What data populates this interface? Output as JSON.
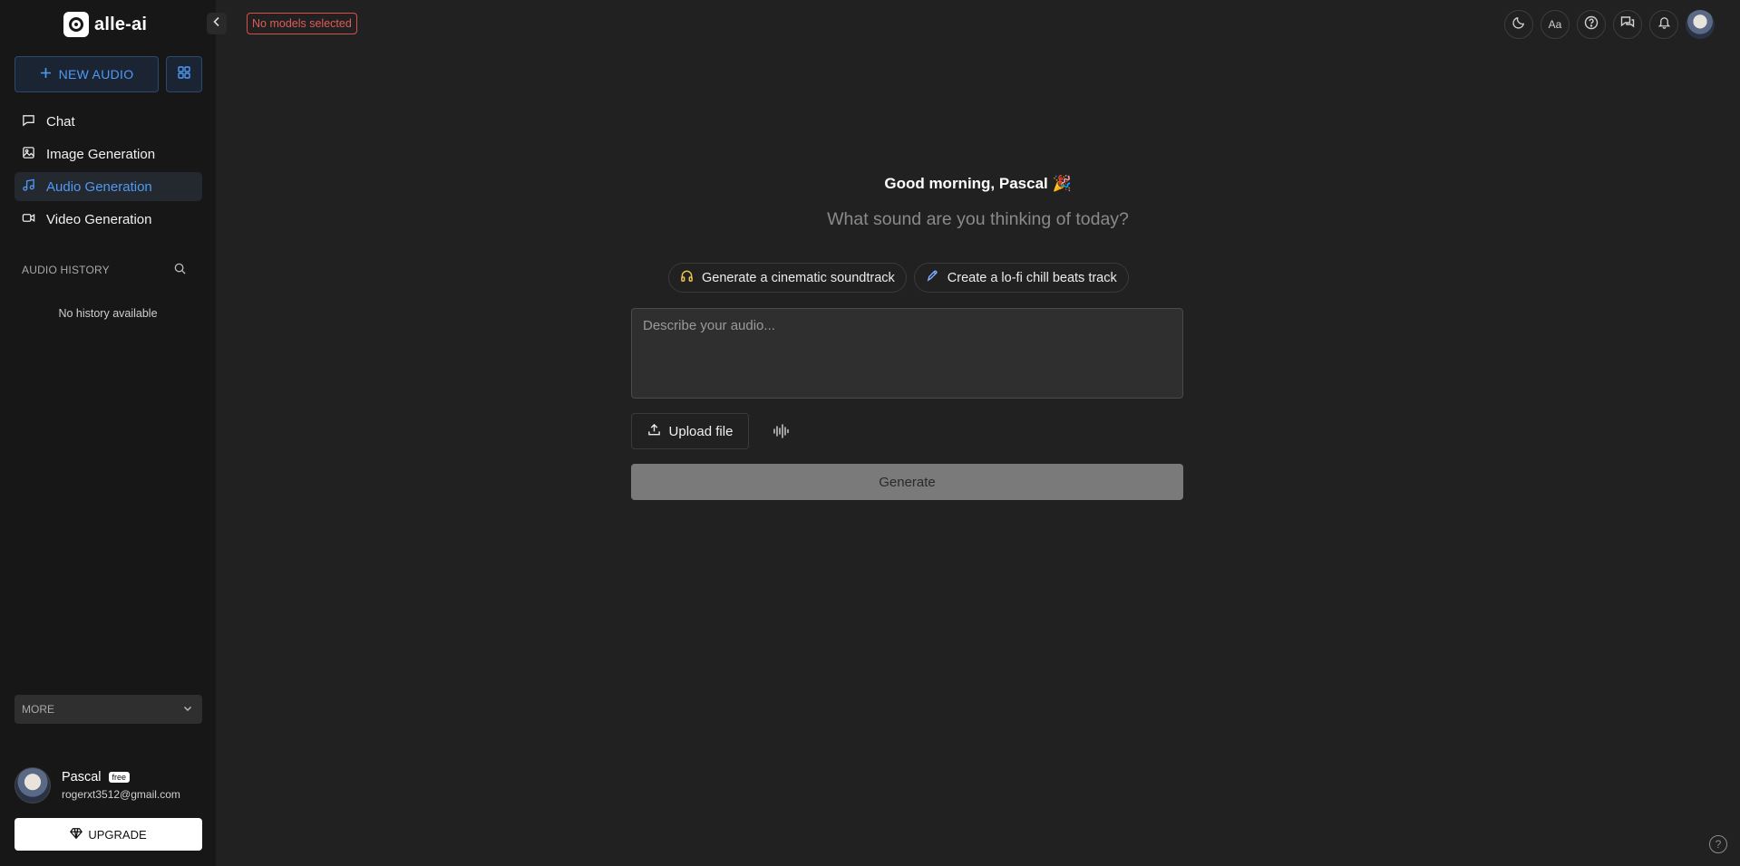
{
  "app": {
    "name": "alle-ai"
  },
  "sidebar": {
    "new_button_label": "NEW AUDIO",
    "nav": [
      {
        "label": "Chat",
        "icon": "chat-icon",
        "active": false
      },
      {
        "label": "Image Generation",
        "icon": "image-icon",
        "active": false
      },
      {
        "label": "Audio Generation",
        "icon": "music-note-icon",
        "active": true
      },
      {
        "label": "Video Generation",
        "icon": "video-icon",
        "active": false
      }
    ],
    "history_title": "AUDIO HISTORY",
    "no_history": "No history available",
    "more_label": "MORE",
    "user": {
      "name": "Pascal",
      "plan": "free",
      "email": "rogerxt3512@gmail.com"
    },
    "upgrade_label": "UPGRADE"
  },
  "topbar": {
    "models_status": "No models selected",
    "icons": [
      "moon-icon",
      "font-size-icon",
      "help-icon",
      "feedback-icon",
      "bell-icon"
    ]
  },
  "main": {
    "greeting": "Good morning, Pascal 🎉",
    "subtitle": "What sound are you thinking of today?",
    "suggestions": [
      {
        "label": "Generate a cinematic soundtrack",
        "icon": "headphones-icon"
      },
      {
        "label": "Create a lo-fi chill beats track",
        "icon": "pen-icon"
      }
    ],
    "prompt_placeholder": "Describe your audio...",
    "upload_label": "Upload file",
    "generate_label": "Generate"
  },
  "colors": {
    "accent": "#4e9af5",
    "background": "#212121",
    "sidebar": "#171717",
    "error": "#e05a5a"
  }
}
